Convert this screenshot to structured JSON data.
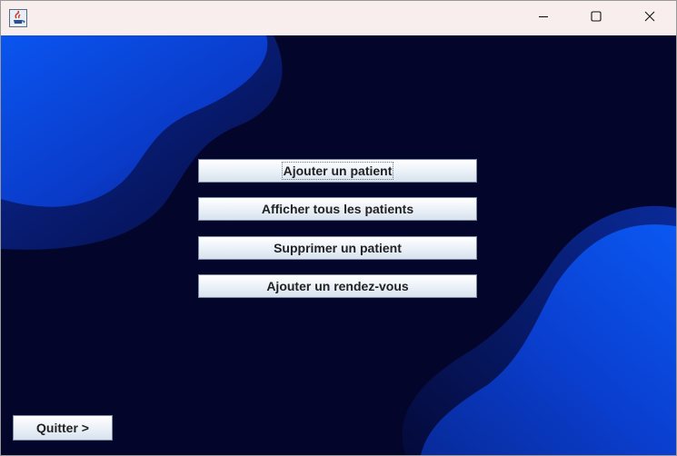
{
  "titlebar": {
    "app_icon": "java-cup-icon",
    "minimize_icon": "minimize-icon",
    "maximize_icon": "maximize-icon",
    "close_icon": "close-icon"
  },
  "menu": {
    "add_patient": "Ajouter un patient",
    "list_patients": "Afficher tous les patients",
    "delete_patient": "Supprimer un patient",
    "add_appointment": "Ajouter un rendez-vous"
  },
  "footer": {
    "quit": "Quitter >"
  },
  "colors": {
    "background": "#03052a",
    "accent_blue": "#0a4fe0",
    "button_border": "#7a8aa0"
  }
}
